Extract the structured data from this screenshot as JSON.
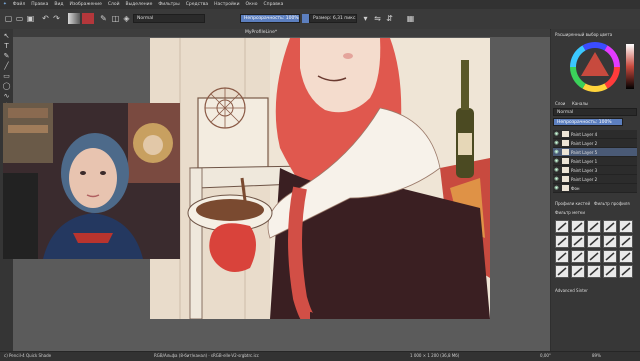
{
  "menu": [
    "Файл",
    "Правка",
    "Вид",
    "Изображение",
    "Слой",
    "Выделение",
    "Фильтры",
    "Средства",
    "Настройки",
    "Окно",
    "Справка"
  ],
  "toolbar": {
    "blend_mode": "Normal",
    "opacity": "Непрозрачность: 100%",
    "size": "Размер: 6,31 пикс."
  },
  "document": {
    "tab_title": "MyProfileLine*"
  },
  "dock": {
    "color_panel_tab": "Расширенный выбор цвета",
    "layers_tabs": [
      "Слои",
      "Каналы"
    ],
    "blend_mode": "Normal",
    "opacity": "Непрозрачность: 100%",
    "layers": [
      {
        "name": "Paint Layer 4",
        "active": false
      },
      {
        "name": "Paint Layer 2",
        "active": false
      },
      {
        "name": "Paint Layer 5",
        "active": true
      },
      {
        "name": "Paint Layer 1",
        "active": false
      },
      {
        "name": "Paint Layer 3",
        "active": false
      },
      {
        "name": "Paint Layer 2",
        "active": false
      },
      {
        "name": "Фон",
        "active": false
      }
    ],
    "presets_title": "Профили кистей",
    "presets_filter": "Фильтр профиля",
    "brush_tag": "Фильтр метки",
    "advanced_label": "Advanced Sinter"
  },
  "status": {
    "brush": "c) Pencil-4 Quick Shade",
    "color_info": "RGB/Альфа (8-бит/канал) · sRGB-elle-V2-srgbtrc.icc",
    "dimensions": "1 000 × 1 200 (36,8 Мб)",
    "rotation": "0,00°",
    "zoom": "89%"
  },
  "colors": {
    "accent": "#4a5a76",
    "canvas_bg": "#efe5d6",
    "hair": "#e0584e"
  }
}
